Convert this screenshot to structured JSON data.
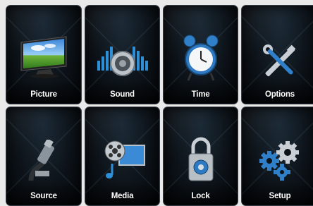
{
  "menu": {
    "items": [
      {
        "label": "Picture",
        "icon": "tv-icon"
      },
      {
        "label": "Sound",
        "icon": "speaker-icon"
      },
      {
        "label": "Time",
        "icon": "alarm-clock-icon"
      },
      {
        "label": "Options",
        "icon": "tools-icon"
      },
      {
        "label": "Source",
        "icon": "hdmi-cable-icon"
      },
      {
        "label": "Media",
        "icon": "film-reel-icon"
      },
      {
        "label": "Lock",
        "icon": "padlock-icon"
      },
      {
        "label": "Setup",
        "icon": "gears-icon"
      }
    ]
  }
}
